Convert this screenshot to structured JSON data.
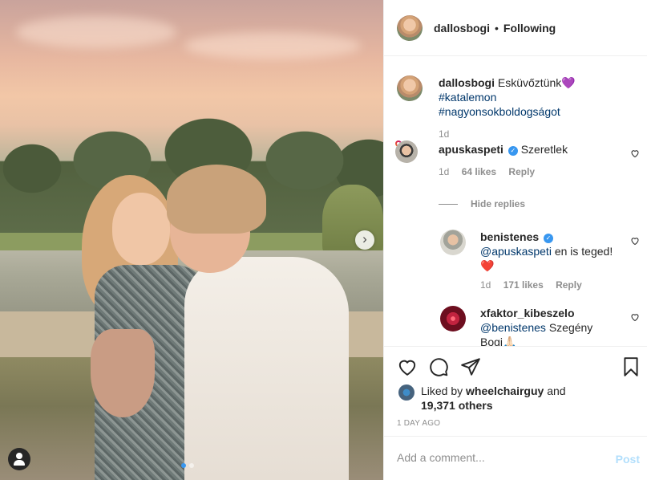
{
  "post": {
    "author": "dallosbogi",
    "follow_state": "Following",
    "dot": "•",
    "next_glyph": "›"
  },
  "caption": {
    "username": "dallosbogi",
    "text": "Esküvőztünk💜",
    "hashtag1": "#katalemon",
    "hashtag2": "#nagyonsokboldogságot",
    "age": "1d"
  },
  "comments": [
    {
      "username": "apuskaspeti",
      "verified": true,
      "text": "Szeretlek",
      "age": "1d",
      "likes": "64 likes",
      "reply_label": "Reply"
    },
    {
      "username": "benistenes",
      "verified": true,
      "mention": "@apuskaspeti",
      "text": "en is teged!",
      "emoji": "❤️",
      "age": "1d",
      "likes": "171 likes",
      "reply_label": "Reply"
    },
    {
      "username": "xfaktor_kibeszelo",
      "verified": false,
      "mention": "@benistenes",
      "text": "Szegény",
      "text2": "Bogi🙏🏻"
    }
  ],
  "hide_replies": "Hide replies",
  "likes": {
    "prefix": "Liked by",
    "user": "wheelchairguy",
    "joiner": "and",
    "others": "19,371 others"
  },
  "timestamp": "1 DAY AGO",
  "add_comment": {
    "placeholder": "Add a comment...",
    "post_label": "Post"
  },
  "colors": {
    "link_blue": "#00376b",
    "verified_blue": "#3897f0",
    "muted": "#8e8e8e",
    "post_disabled": "#b2dffc"
  }
}
